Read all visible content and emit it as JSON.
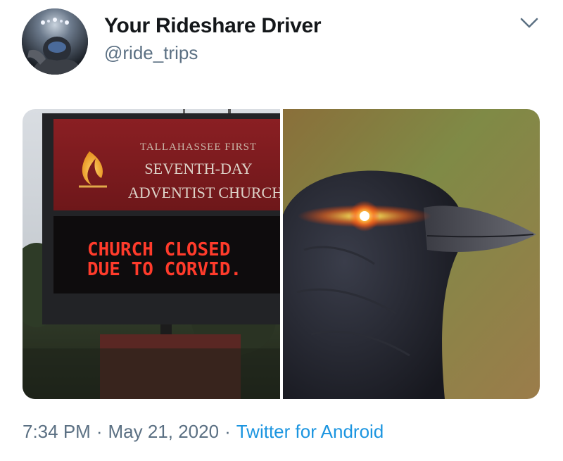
{
  "author": {
    "name": "Your Rideshare Driver",
    "handle": "@ride_trips"
  },
  "icons": {
    "avatar": "avatar-photo",
    "menu": "chevron-down-icon"
  },
  "media": {
    "left": {
      "sign_header": [
        "TALLAHASSEE FIRST",
        "SEVENTH-DAY",
        "ADVENTIST CHURCH"
      ],
      "led_lines": [
        "CHURCH CLOSED",
        "DUE TO CORVID."
      ]
    }
  },
  "footer": {
    "time": "7:34 PM",
    "separator": "·",
    "date": "May 21, 2020",
    "source": "Twitter for Android"
  },
  "colors": {
    "name": "#14171a",
    "muted": "#5b7083",
    "link": "#1b95e0",
    "led_red": "#ff3b2b"
  }
}
